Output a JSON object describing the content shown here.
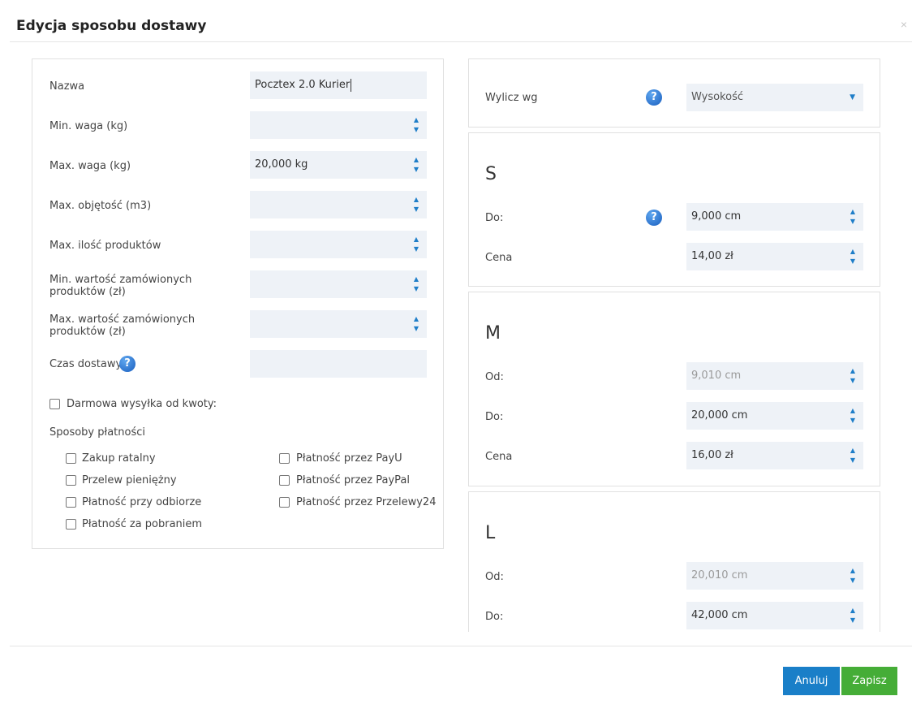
{
  "modal": {
    "title": "Edycja sposobu dostawy",
    "close_symbol": "×"
  },
  "form": {
    "name": {
      "label": "Nazwa",
      "value": "Pocztex 2.0 Kurier"
    },
    "min_weight": {
      "label": "Min. waga (kg)",
      "value": ""
    },
    "max_weight": {
      "label": "Max. waga (kg)",
      "value": "20,000 kg"
    },
    "max_volume": {
      "label": "Max. objętość (m3)",
      "value": ""
    },
    "max_products": {
      "label": "Max. ilość produktów",
      "value": ""
    },
    "min_order_value": {
      "label_line1": "Min. wartość zamówionych",
      "label_line2": "produktów (zł)",
      "value": ""
    },
    "max_order_value": {
      "label_line1": "Max. wartość zamówionych",
      "label_line2": "produktów (zł)",
      "value": ""
    },
    "delivery_time": {
      "label": "Czas dostawy",
      "value": ""
    },
    "free_shipping_label": "Darmowa wysyłka od kwoty:",
    "payment_methods_label": "Sposoby płatności",
    "payments_left": [
      "Zakup ratalny",
      "Przelew pieniężny",
      "Płatność przy odbiorze",
      "Płatność za pobraniem"
    ],
    "payments_right": [
      "Płatność przez PayU",
      "Płatność przez PayPal",
      "Płatność przez Przelewy24"
    ]
  },
  "calc": {
    "label": "Wylicz wg",
    "value": "Wysokość"
  },
  "sizes": {
    "s": {
      "title": "S",
      "to_label": "Do:",
      "to_value": "9,000 cm",
      "price_label": "Cena",
      "price_value": "14,00 zł"
    },
    "m": {
      "title": "M",
      "from_label": "Od:",
      "from_value": "9,010 cm",
      "to_label": "Do:",
      "to_value": "20,000 cm",
      "price_label": "Cena",
      "price_value": "16,00 zł"
    },
    "l": {
      "title": "L",
      "from_label": "Od:",
      "from_value": "20,010 cm",
      "to_label": "Do:",
      "to_value": "42,000 cm"
    }
  },
  "help_symbol": "?",
  "spin_up": "▲",
  "spin_down": "▼",
  "select_caret": "▼",
  "footer": {
    "cancel_label": "Anuluj",
    "save_label": "Zapisz"
  },
  "colors": {
    "primary": "#1a7fc8",
    "success": "#45ad37",
    "field_bg": "#eef2f7"
  }
}
